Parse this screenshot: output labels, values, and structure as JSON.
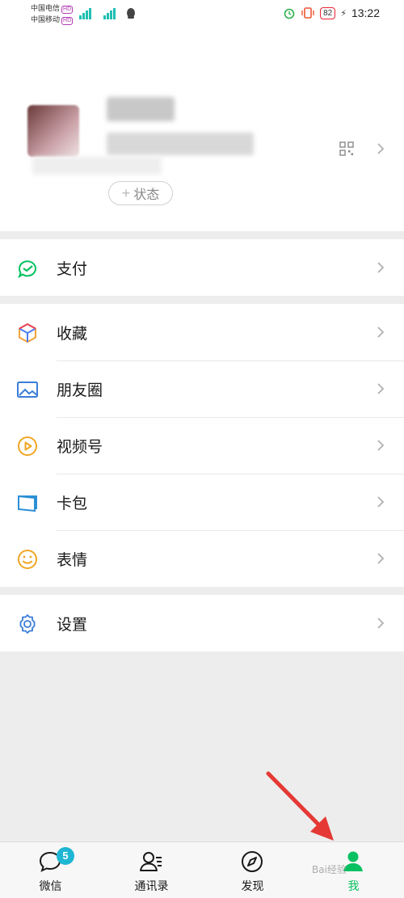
{
  "status_bar": {
    "carrier1": "中国电信",
    "carrier2": "中国移动",
    "hd_label": "HD",
    "battery": "82",
    "time": "13:22"
  },
  "profile": {
    "status_label": "状态",
    "status_plus": "+"
  },
  "menu": {
    "pay": "支付",
    "favorites": "收藏",
    "moments": "朋友圈",
    "channels": "视频号",
    "cards": "卡包",
    "stickers": "表情",
    "settings": "设置"
  },
  "tabbar": {
    "chats": "微信",
    "chats_badge": "5",
    "contacts": "通讯录",
    "discover": "发现",
    "me": "我",
    "watermark": "Bai经验"
  },
  "colors": {
    "accent": "#07c160",
    "badge": "#1fb6d4",
    "arrow": "#e53935"
  }
}
